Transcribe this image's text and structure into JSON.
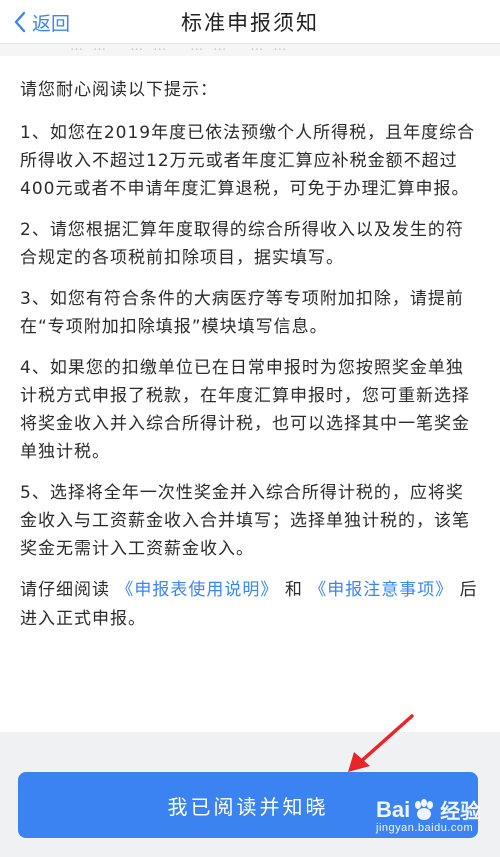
{
  "header": {
    "back_label": "返回",
    "title": "标准申报须知"
  },
  "content": {
    "faded_line": "…… …… …… ……",
    "intro": "请您耐心阅读以下提示：",
    "items": [
      "1、如您在2019年度已依法预缴个人所得税，且年度综合所得收入不超过12万元或者年度汇算应补税金额不超过400元或者不申请年度汇算退税，可免于办理汇算申报。",
      "2、请您根据汇算年度取得的综合所得收入以及发生的符合规定的各项税前扣除项目，据实填写。",
      "3、如您有符合条件的大病医疗等专项附加扣除，请提前在“专项附加扣除填报”模块填写信息。",
      "4、如果您的扣缴单位已在日常申报时为您按照奖金单独计税方式申报了税款，在年度汇算申报时，您可重新选择将奖金收入并入综合所得计税，也可以选择其中一笔奖金单独计税。",
      "5、选择将全年一次性奖金并入综合所得计税的，应将奖金收入与工资薪金收入合并填写；选择单独计税的，该笔奖金无需计入工资薪金收入。"
    ],
    "note_prefix": "请仔细阅读",
    "link1": "《申报表使用说明》",
    "note_mid": "和",
    "link2": "《申报注意事项》",
    "note_suffix": "后进入正式申报。"
  },
  "footer": {
    "confirm_label": "我已阅读并知晓"
  },
  "watermark": {
    "brand_left": "Bai",
    "brand_right": "经验",
    "url": "jingyan.baidu.com"
  },
  "colors": {
    "accent": "#3b83f0",
    "link": "#3a86f2",
    "annotation_arrow": "#e8262a"
  }
}
